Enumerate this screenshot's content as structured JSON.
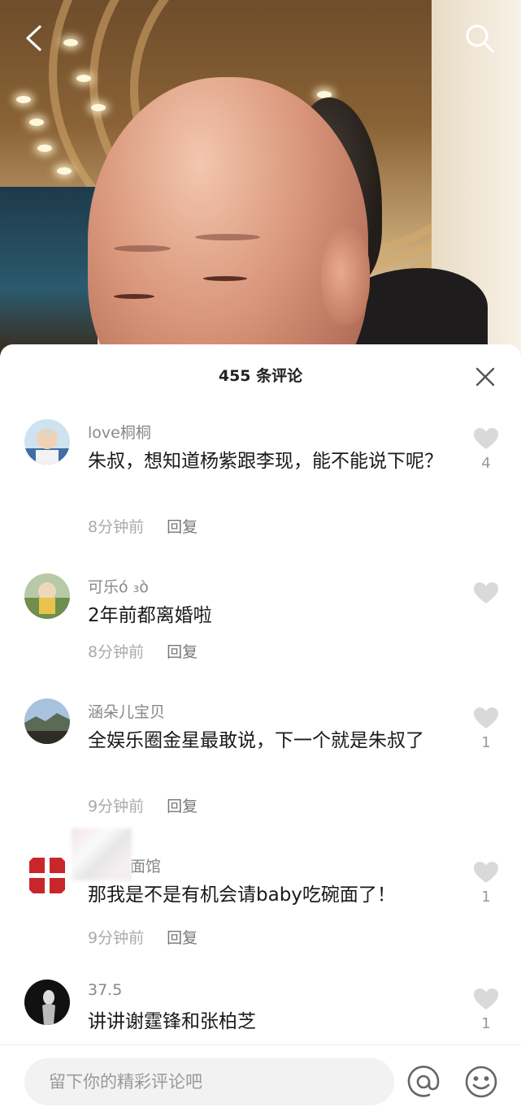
{
  "video": {
    "back_icon": "chevron-left-icon",
    "search_icon": "search-icon"
  },
  "comments_panel": {
    "title": "455 条评论",
    "close_icon": "close-icon",
    "comments": [
      {
        "user": "love桐桐",
        "text": "朱叔，想知道杨紫跟李现，能不能说下呢？",
        "time": "8分钟前",
        "reply": "回复",
        "likes": "4"
      },
      {
        "user": "可乐ό ₃ὸ",
        "text": "2年前都离婚啦",
        "time": "8分钟前",
        "reply": "回复",
        "likes": ""
      },
      {
        "user": "涵朵儿宝贝",
        "text": "全娱乐圈金星最敢说，下一个就是朱叔了",
        "time": "9分钟前",
        "reply": "回复",
        "likes": "1"
      },
      {
        "user": "面馆",
        "text": "那我是不是有机会请baby吃碗面了！",
        "time": "9分钟前",
        "reply": "回复",
        "likes": "1"
      },
      {
        "user": "37.5",
        "text": "讲讲谢霆锋和张柏芝",
        "time": "",
        "reply": "",
        "likes": "1"
      }
    ]
  },
  "input_bar": {
    "placeholder": "留下你的精彩评论吧",
    "at_icon": "at-icon",
    "emoji_icon": "emoji-icon"
  },
  "colors": {
    "sheet_background": "#ffffff",
    "name_color": "#888888",
    "text_color": "#1a1a1a",
    "meta_color": "#aaaaaa",
    "like_icon_color": "#d9d9d9"
  }
}
